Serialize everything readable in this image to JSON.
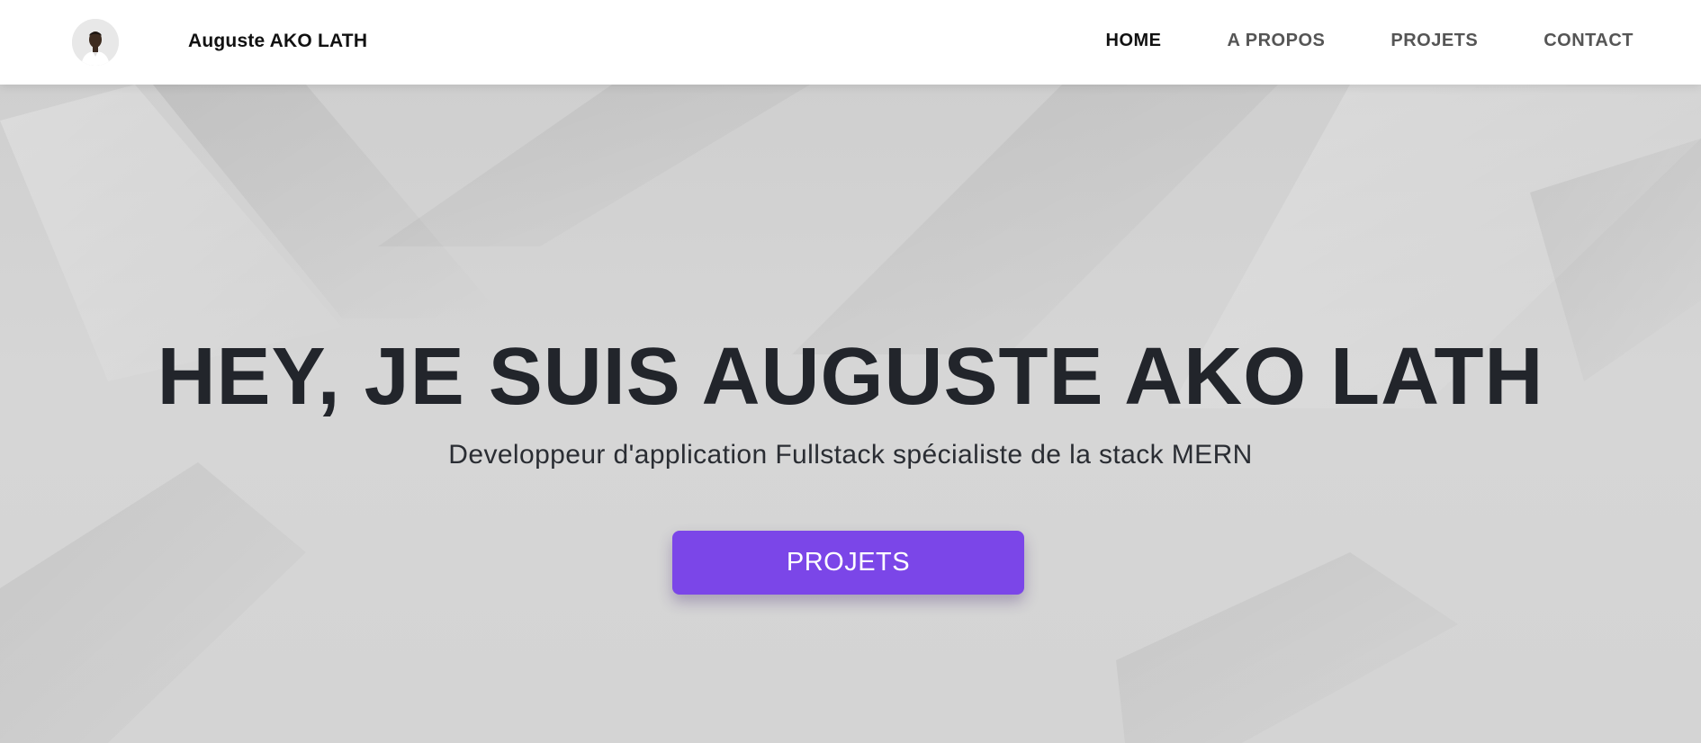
{
  "header": {
    "brand_name": "Auguste AKO LATH",
    "avatar_alt": "Auguste AKO LATH profile photo",
    "nav": [
      {
        "label": "HOME",
        "active": true
      },
      {
        "label": "A PROPOS",
        "active": false
      },
      {
        "label": "PROJETS",
        "active": false
      },
      {
        "label": "CONTACT",
        "active": false
      }
    ]
  },
  "hero": {
    "title": "HEY, JE SUIS AUGUSTE AKO LATH",
    "subtitle": "Developpeur d'application Fullstack spécialiste de la stack MERN",
    "cta_label": "PROJETS"
  },
  "colors": {
    "accent": "#7b46e8",
    "nav_active": "#111111",
    "nav_inactive": "#555555",
    "hero_background": "#d4d4d4",
    "title_text": "#22252b"
  }
}
